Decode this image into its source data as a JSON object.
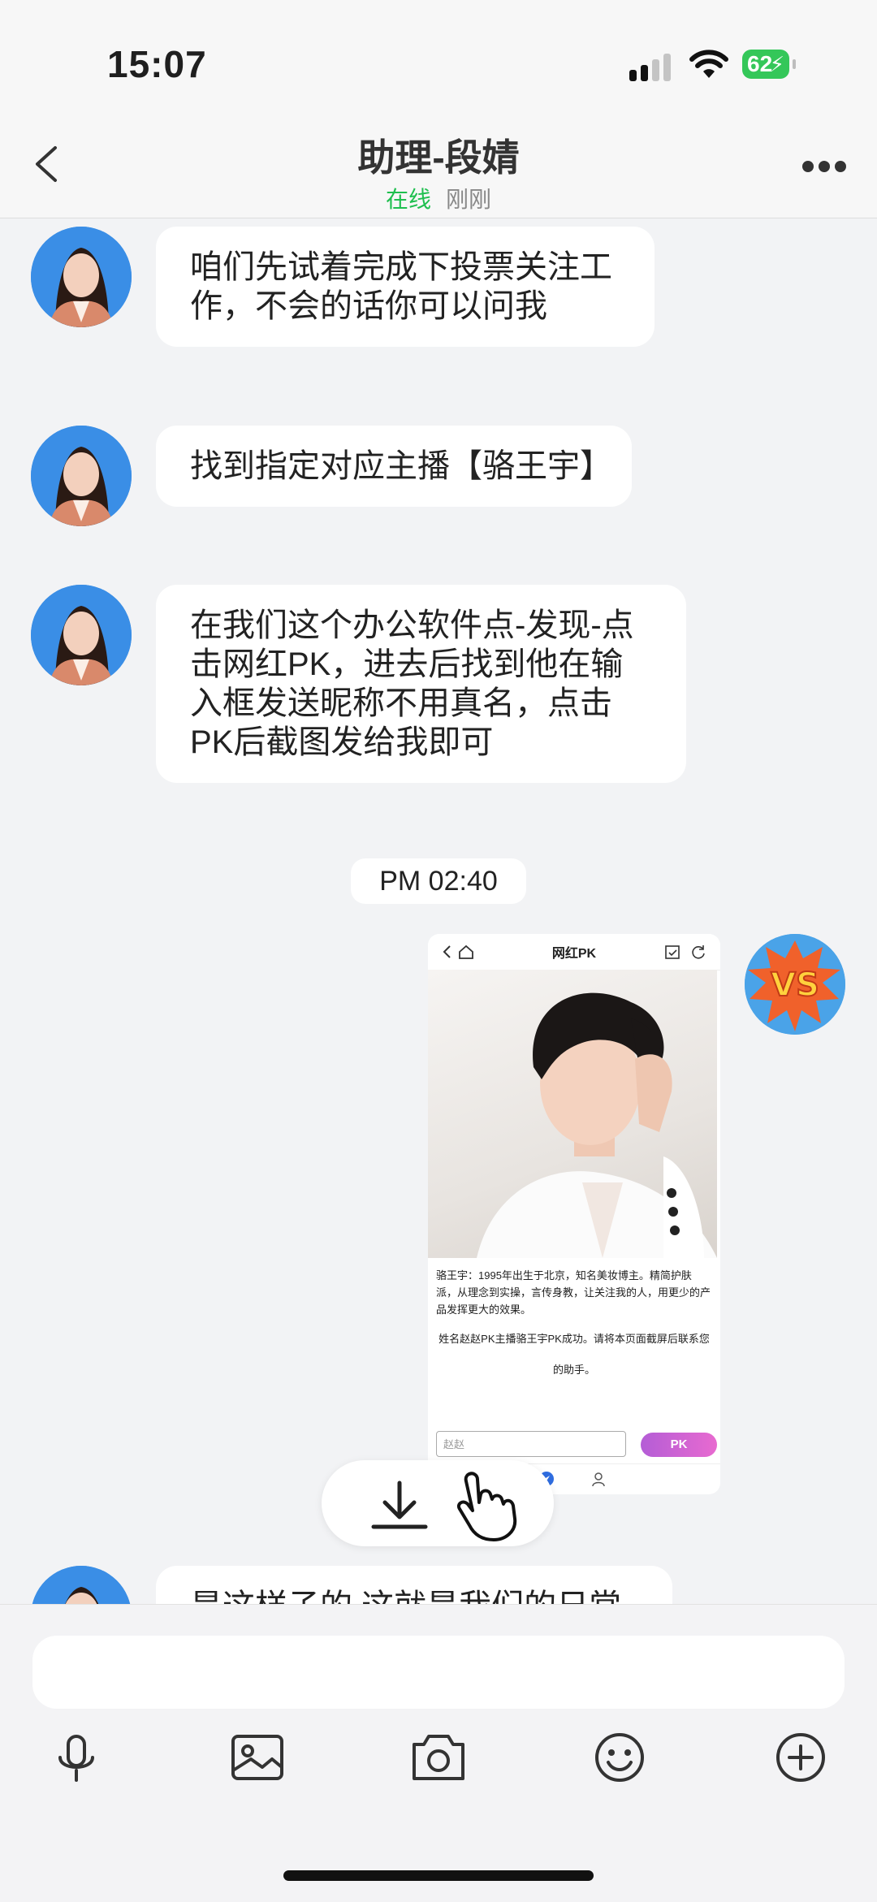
{
  "status_bar": {
    "time": "15:07",
    "battery": "62"
  },
  "header": {
    "title": "助理-段婧",
    "status": "在线",
    "last_seen": "刚刚"
  },
  "messages": [
    {
      "text": "咱们先试着完成下投票关注工作，不会的话你可以问我"
    },
    {
      "text": "找到指定对应主播【骆王宇】"
    },
    {
      "text": "在我们这个办公软件点-发现-点击网红PK，进去后找到他在输入框发送昵称不用真名，点击PK后截图发给我即可"
    },
    {
      "text": "是这样子的 这就是我们的日常"
    }
  ],
  "time_divider": "PM 02:40",
  "sent_screenshot": {
    "title": "网红PK",
    "bio": "骆王宇：1995年出生于北京，知名美妆博主。精简护肤派，从理念到实操，言传身教，让关注我的人，用更少的产品发挥更大的效果。",
    "result_msg": "姓名赵赵PK主播骆王宇PK成功。请将本页面截屏后联系您的助手。",
    "input_value": "赵赵",
    "pk_button": "PK"
  },
  "colors": {
    "online": "#1fbf4f",
    "avatar_bg": "#3a8ee6",
    "vs_orange": "#f0612b",
    "pk_gradient": "#b45dd6"
  },
  "icons": [
    "back-chevron-icon",
    "more-dots-icon",
    "download-icon",
    "hand-pointer-icon",
    "microphone-icon",
    "image-icon",
    "camera-icon",
    "emoji-icon",
    "plus-circle-icon"
  ]
}
